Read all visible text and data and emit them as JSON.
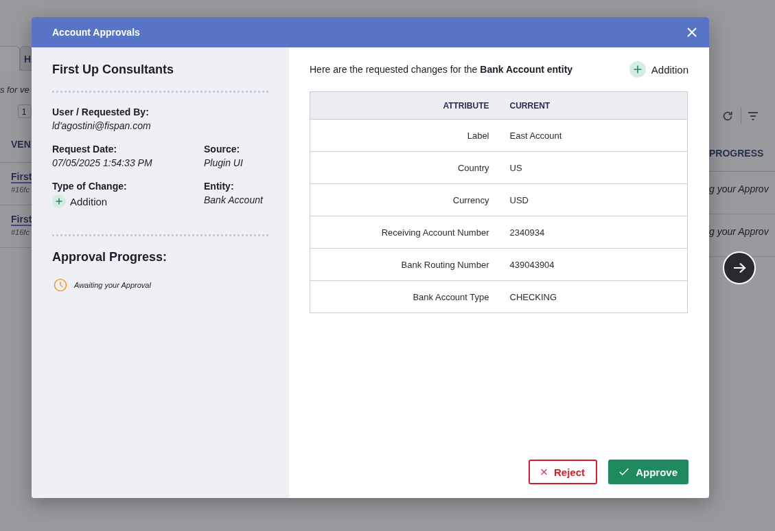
{
  "background": {
    "tabs": [
      {
        "selected": true
      },
      {
        "label": "H",
        "selected": false
      }
    ],
    "subtitle": "s for ve",
    "page_number": "1",
    "left_header": "VEN",
    "right_header": "PROGRESS",
    "rows": [
      {
        "name": "First",
        "id": "#16fc",
        "progress": "g your Approv"
      },
      {
        "name": "First",
        "id": "#16fc",
        "progress": "g your Approv"
      }
    ]
  },
  "modal": {
    "title": "Account Approvals",
    "company": "First Up Consultants",
    "requested_by": {
      "label": "User / Requested By:",
      "value": "ld'agostini@fispan.com"
    },
    "request_date": {
      "label": "Request Date:",
      "value": "07/05/2025 1:54:33 PM"
    },
    "source": {
      "label": "Source:",
      "value": "Plugin UI"
    },
    "type_of_change": {
      "label": "Type of Change:",
      "value": "Addition",
      "kind": "addition"
    },
    "entity": {
      "label": "Entity:",
      "value": "Bank Account"
    },
    "approval_progress": {
      "title": "Approval Progress:",
      "steps": [
        {
          "kind": "awaiting",
          "text": "Awaiting your Approval"
        }
      ]
    },
    "intro": "Here are the requested changes for the **Bank Account entity**",
    "change_badge": {
      "label": "Addition",
      "kind": "addition"
    },
    "table": {
      "columns": [
        "ATTRIBUTE",
        "CURRENT"
      ],
      "rows": [
        {
          "attribute": "Label",
          "current": "East Account"
        },
        {
          "attribute": "Country",
          "current": "US"
        },
        {
          "attribute": "Currency",
          "current": "USD"
        },
        {
          "attribute": "Receiving Account Number",
          "current": "2340934"
        },
        {
          "attribute": "Bank Routing Number",
          "current": "439043904"
        },
        {
          "attribute": "Bank Account Type",
          "current": "CHECKING"
        }
      ]
    },
    "buttons": [
      {
        "label": "Reject",
        "kind": "reject"
      },
      {
        "label": "Approve",
        "kind": "approve"
      }
    ]
  }
}
